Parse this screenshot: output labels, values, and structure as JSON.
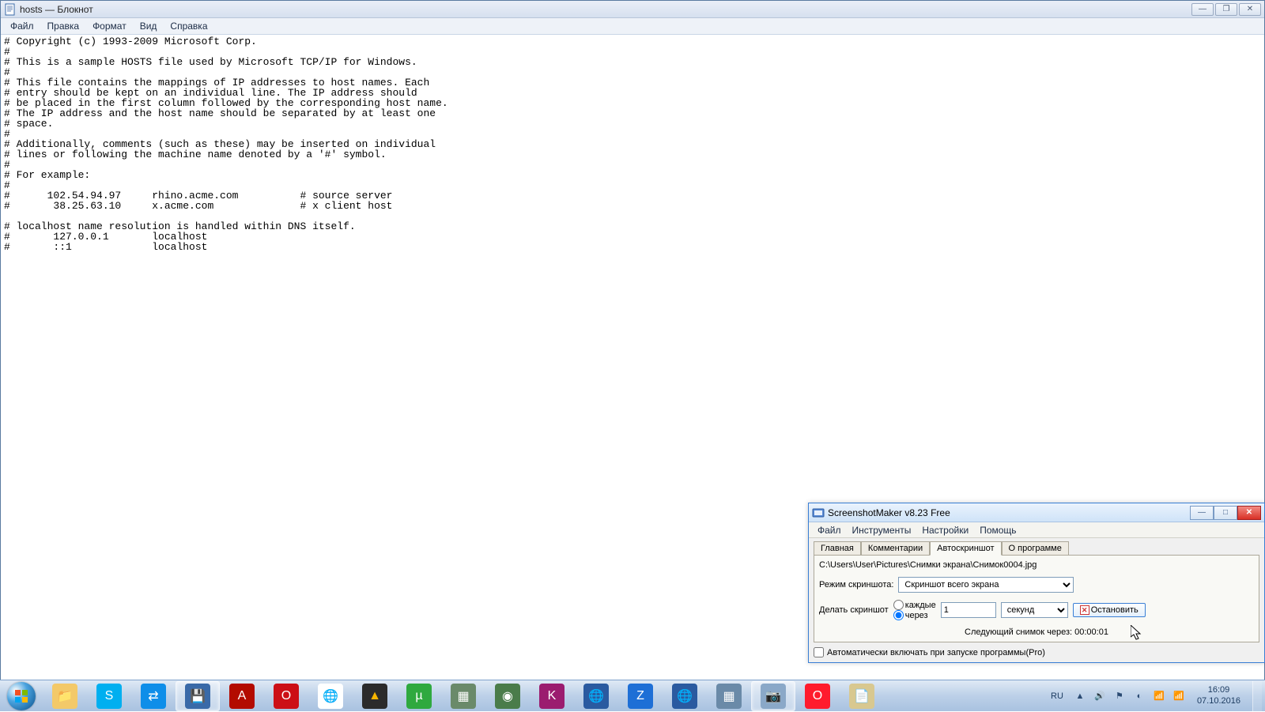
{
  "notepad": {
    "title": "hosts — Блокнот",
    "menus": [
      "Файл",
      "Правка",
      "Формат",
      "Вид",
      "Справка"
    ],
    "content": "# Copyright (c) 1993-2009 Microsoft Corp.\n#\n# This is a sample HOSTS file used by Microsoft TCP/IP for Windows.\n#\n# This file contains the mappings of IP addresses to host names. Each\n# entry should be kept on an individual line. The IP address should\n# be placed in the first column followed by the corresponding host name.\n# The IP address and the host name should be separated by at least one\n# space.\n#\n# Additionally, comments (such as these) may be inserted on individual\n# lines or following the machine name denoted by a '#' symbol.\n#\n# For example:\n#\n#      102.54.94.97     rhino.acme.com          # source server\n#       38.25.63.10     x.acme.com              # x client host\n\n# localhost name resolution is handled within DNS itself.\n#\t127.0.0.1       localhost\n#\t::1             localhost"
  },
  "dialog": {
    "title": "ScreenshotMaker v8.23 Free",
    "menus": [
      "Файл",
      "Инструменты",
      "Настройки",
      "Помощь"
    ],
    "tabs": {
      "main": "Главная",
      "comments": "Комментарии",
      "auto": "Автоскриншот",
      "about": "О программе"
    },
    "path": "C:\\Users\\User\\Pictures\\Снимки экрана\\Снимок0004.jpg",
    "mode_label": "Режим скриншота:",
    "mode_value": "Скриншот всего экрана",
    "do_label": "Делать скриншот",
    "radio_every": "каждые",
    "radio_after": "через",
    "interval_value": "1",
    "unit_value": "секунд",
    "stop_label": "Остановить",
    "next_label": "Следующий снимок через: 00:00:01",
    "autorun_label": "Автоматически включать при запуске программы(Pro)"
  },
  "taskbar": {
    "lang": "RU",
    "time": "16:09",
    "date": "07.10.2016"
  }
}
